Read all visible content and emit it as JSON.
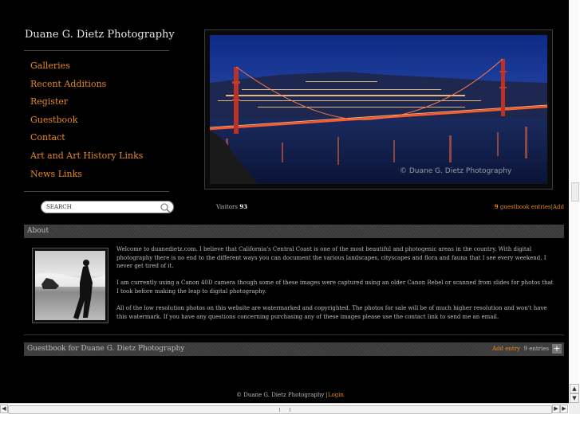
{
  "site": {
    "title": "Duane G. Dietz Photography"
  },
  "nav": [
    "Galleries",
    "Recent Additions",
    "Register",
    "Guestbook",
    "Contact",
    "Art and Art History Links",
    "News Links"
  ],
  "search": {
    "placeholder": "SEARCH",
    "icon": "magnifier-icon"
  },
  "hero": {
    "watermark": "© Duane G. Dietz Photography"
  },
  "stats": {
    "visitors_label": "Visitors",
    "visitors_count": "93",
    "guestbook_count": "9",
    "guestbook_label": "guestbook entries",
    "separator": "|",
    "add_label": "Add"
  },
  "about": {
    "heading": "About",
    "paragraphs": [
      "Welcome to duanedietz.com. I believe that California's Central Coast is one of the most beautiful and photogenic areas in the country. With digital photography there is no end to the different ways you can document the various landscapes, cityscapes and flora and fauna that I see every weekend. I never get tired of it.",
      "I am currently using a Canon 40D camera though some of these images were captured using an older Canon Rebel or scanned from slides for photos that I took before making the leap to digital photography.",
      "All of the low resolution photos on this website are watermarked and copyrighted. The photos for sale will be of much higher resolution and won't have this watermark. If you have any questions concerning purchasing any of these images please use the contact link to send me an email."
    ]
  },
  "guestbook": {
    "title": "Guestbook for Duane G. Dietz Photography",
    "add_entry": "Add entry",
    "entries": "9 entries",
    "plus": "+"
  },
  "footer": {
    "copyright": "© Duane G. Dietz Photography",
    "separator": "|",
    "login": "Login"
  },
  "colors": {
    "accent": "#e8891f",
    "background": "#000000",
    "bar": "#3a3a3a"
  }
}
